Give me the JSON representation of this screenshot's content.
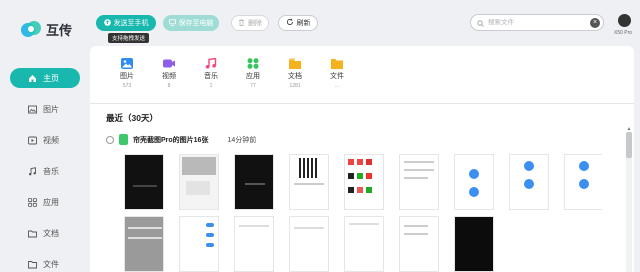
{
  "app": {
    "name": "互传"
  },
  "sidebar": {
    "items": [
      {
        "label": "主页",
        "icon": "home-icon",
        "active": true
      },
      {
        "label": "图片",
        "icon": "image-icon"
      },
      {
        "label": "视频",
        "icon": "video-icon"
      },
      {
        "label": "音乐",
        "icon": "music-icon"
      },
      {
        "label": "应用",
        "icon": "apps-icon"
      },
      {
        "label": "文档",
        "icon": "document-icon"
      },
      {
        "label": "文件",
        "icon": "folder-icon"
      }
    ]
  },
  "toolbar": {
    "send_to_phone": "发送至手机",
    "save_to_pc": "保存至电脑",
    "delete": "删除",
    "refresh": "刷新",
    "tooltip": "支持拖拽发送"
  },
  "search": {
    "placeholder": "搜索文件"
  },
  "device": {
    "name": "X50 Pro"
  },
  "categories": [
    {
      "label": "图片",
      "count": "573",
      "icon": "image-icon",
      "color": "#2f8cf2"
    },
    {
      "label": "视频",
      "count": "8",
      "icon": "video-icon",
      "color": "#8f5ee8"
    },
    {
      "label": "音乐",
      "count": "1",
      "icon": "music-icon",
      "color": "#ee4a7c"
    },
    {
      "label": "应用",
      "count": "77",
      "icon": "apps-icon",
      "color": "#37c45f"
    },
    {
      "label": "文档",
      "count": "1281",
      "icon": "document-icon",
      "color": "#f4b21f"
    },
    {
      "label": "文件",
      "count": "...",
      "icon": "folder-icon",
      "color": "#f4b21f"
    }
  ],
  "recent": {
    "title": "最近（30天）",
    "group": {
      "name": "帘壳截图Pro的图片16张",
      "time": "14分钟前"
    }
  },
  "colors": {
    "accent": "#19b8ae",
    "background": "#eef0f3"
  }
}
